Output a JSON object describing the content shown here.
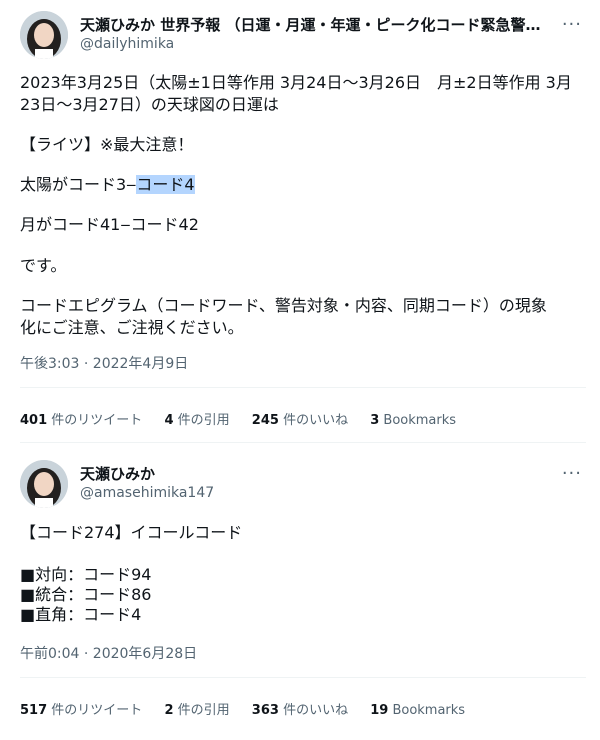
{
  "tweets": [
    {
      "author": "天瀬ひみか 世界予報 （日運・月運・年運・ピーク化コード緊急警…",
      "handle": "@dailyhimika",
      "lines": [
        "2023年3月25日（太陽±1日等作用 3月24日〜3月26日　月±2日等作用 3月",
        "23日〜3月27日）の天球図の日運は",
        "【ライツ】※最大注意！",
        "太陽がコード3‒",
        "コード4",
        "月がコード41‒コード42",
        "です。",
        "コードエピグラム（コードワード、警告対象・内容、同期コード）の現象",
        "化にご注意、ご注視ください。"
      ],
      "timestamp": "午後3:03 · 2022年4月9日",
      "stats": [
        {
          "count": "401",
          "label": "件のリツイート"
        },
        {
          "count": "4",
          "label": "件の引用"
        },
        {
          "count": "245",
          "label": "件のいいね"
        },
        {
          "count": "3",
          "label": "Bookmarks"
        }
      ]
    },
    {
      "author": "天瀬ひみか",
      "handle": "@amasehimika147",
      "lines": [
        "【コード274】イコールコード",
        "■対向：コード94",
        "■統合：コード86",
        "■直角：コード4"
      ],
      "timestamp": "午前0:04 · 2020年6月28日",
      "stats": [
        {
          "count": "517",
          "label": "件のリツイート"
        },
        {
          "count": "2",
          "label": "件の引用"
        },
        {
          "count": "363",
          "label": "件のいいね"
        },
        {
          "count": "19",
          "label": "Bookmarks"
        }
      ]
    }
  ],
  "more_glyph": "···",
  "colors": {
    "text": "#0f1419",
    "secondary": "#536471",
    "highlight": "#b4d5fe",
    "divider": "#eff3f4"
  }
}
